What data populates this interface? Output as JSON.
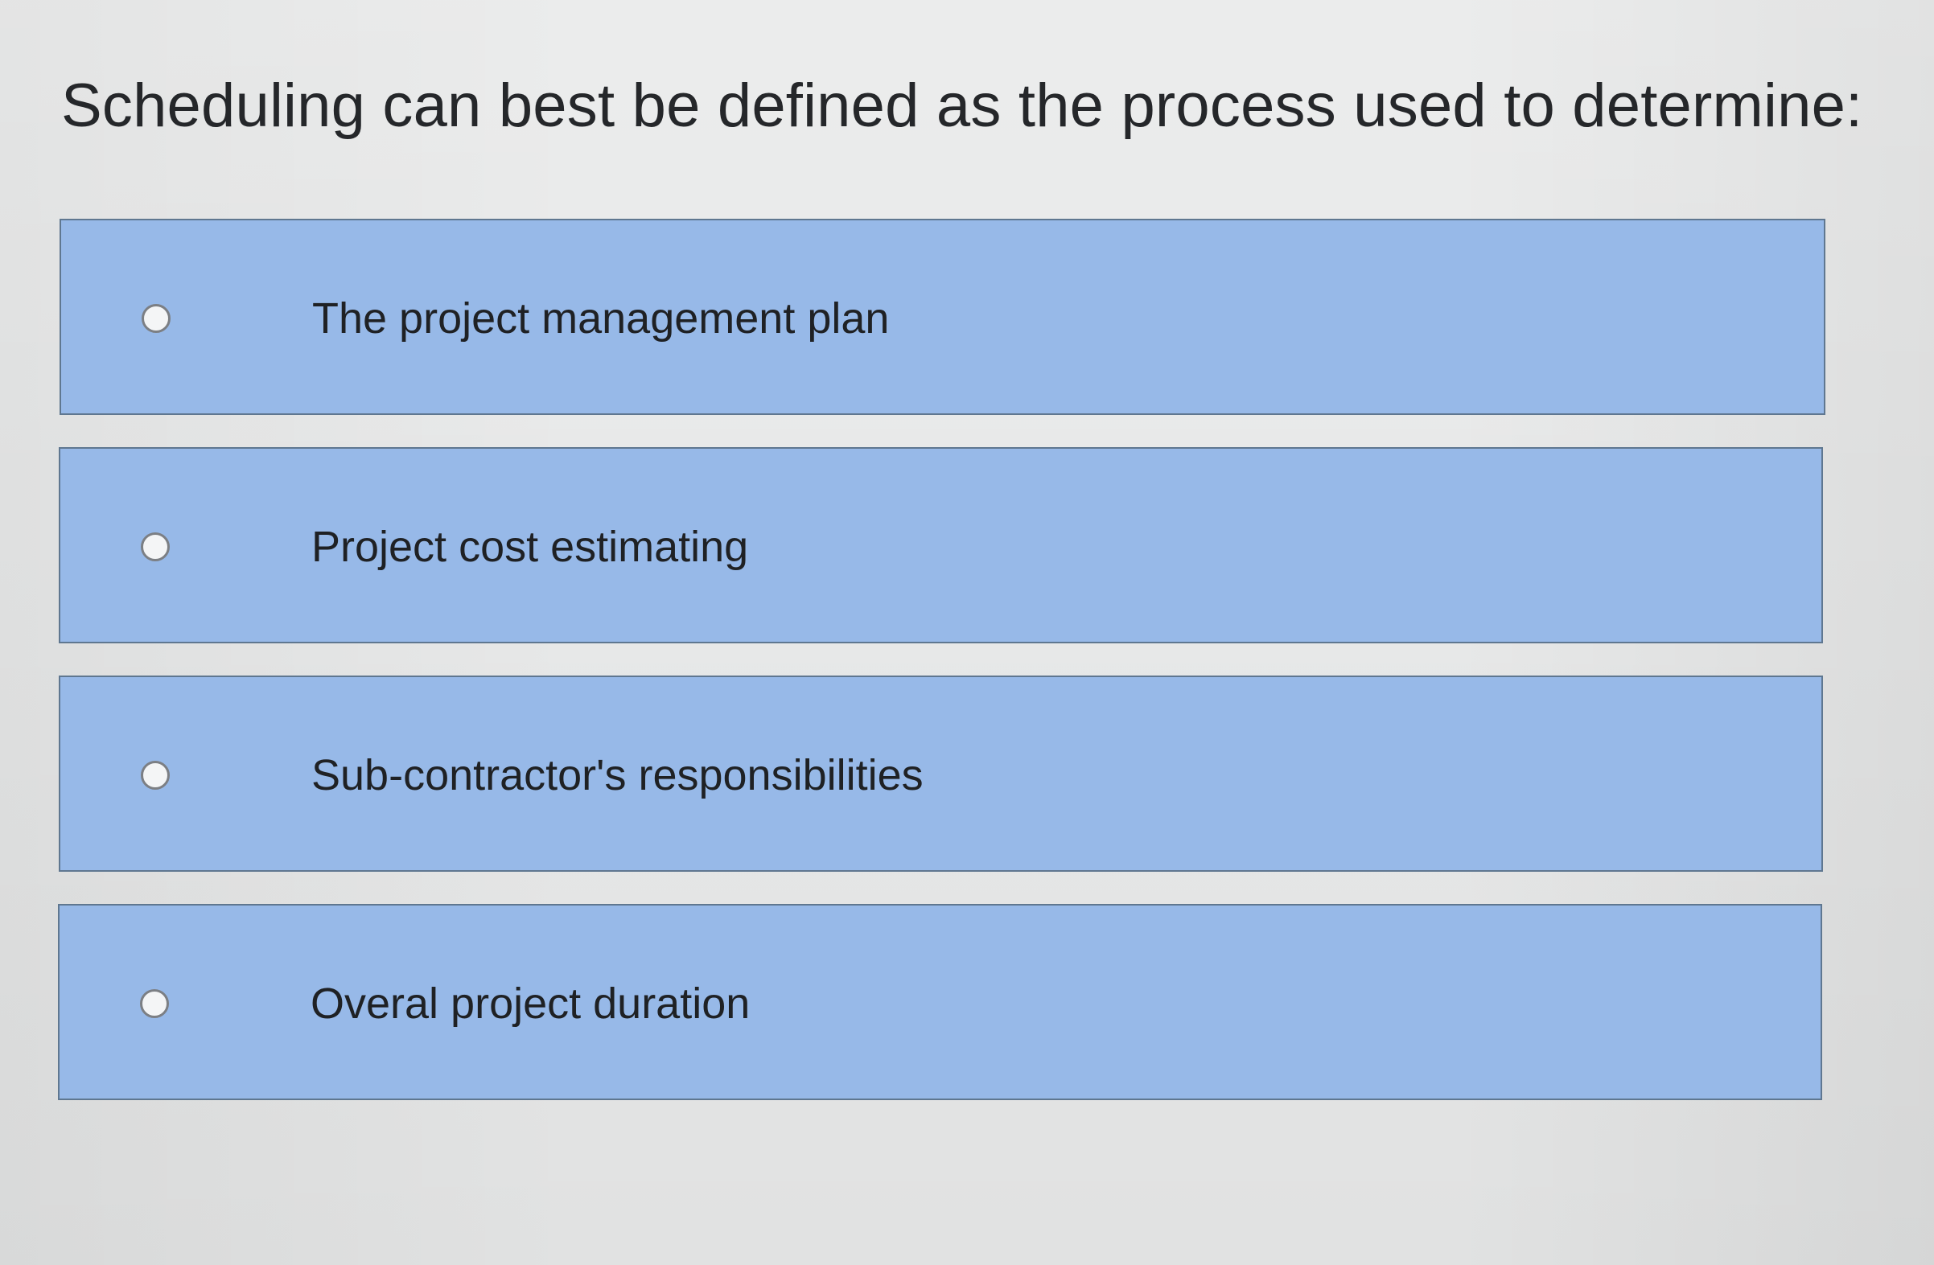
{
  "question": {
    "text": "Scheduling can best be defined as the process used to determine:"
  },
  "options": [
    {
      "label": "The project management plan",
      "selected": false
    },
    {
      "label": "Project cost estimating",
      "selected": false
    },
    {
      "label": "Sub-contractor's responsibilities",
      "selected": false
    },
    {
      "label": "Overal project duration",
      "selected": false
    }
  ],
  "colors": {
    "option_background": "#97b9e8",
    "option_border": "#5f7790",
    "page_background": "#e8e9e9",
    "radio_fill": "#f4f5f6",
    "text": "#1f2124"
  },
  "icons": {
    "radio": "radio-button-unchecked-icon"
  }
}
